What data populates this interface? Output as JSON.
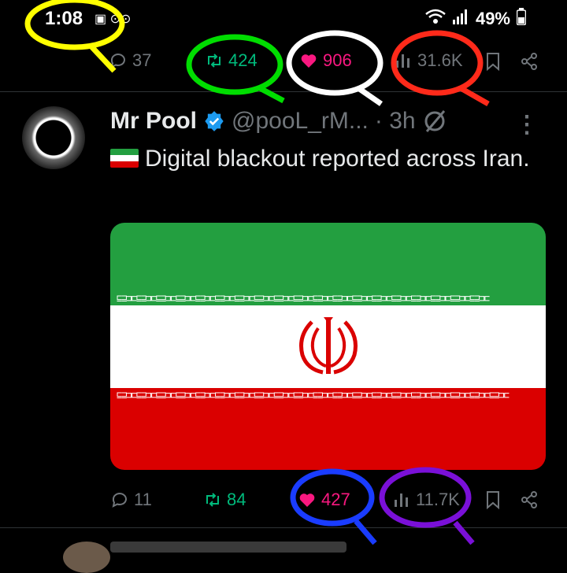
{
  "status_bar": {
    "time": "1:08",
    "battery": "49%"
  },
  "top_actions": {
    "replies": "37",
    "retweets": "424",
    "likes": "906",
    "views": "31.6K"
  },
  "tweet": {
    "name": "Mr Pool",
    "handle": "@pooL_rM...",
    "time": "· 3h",
    "text": "Digital blackout reported across Iran.",
    "flag_colors": [
      "#239f40",
      "#ffffff",
      "#da0000"
    ],
    "actions": {
      "replies": "11",
      "retweets": "84",
      "likes": "427",
      "views": "11.7K"
    }
  },
  "annotation_colors": {
    "time": "#ffff00",
    "retweets": "#00dd00",
    "likes": "#ffffff",
    "views": "#ff2a1a",
    "likes2": "#1a3cff",
    "views2": "#7a10d8"
  },
  "icons": [
    "reply-icon",
    "retweet-icon",
    "heart-icon",
    "views-icon",
    "bookmark-icon",
    "share-icon",
    "verified-icon",
    "grok-icon",
    "more-icon"
  ]
}
